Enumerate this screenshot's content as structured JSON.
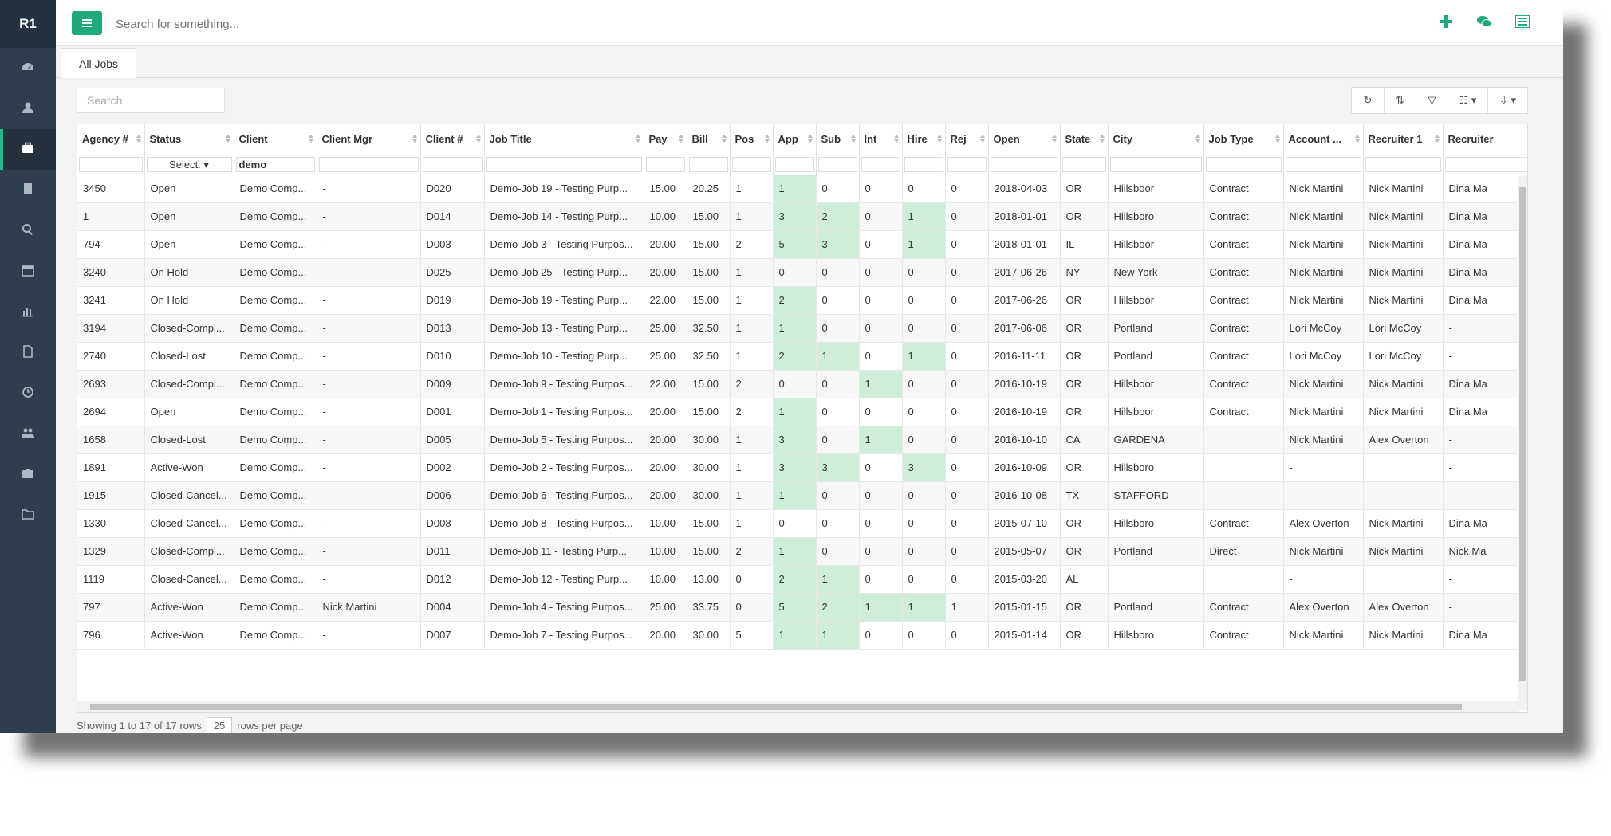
{
  "app": {
    "brand": "R1"
  },
  "sidebar": {
    "items": [
      {
        "icon": "dashboard-icon"
      },
      {
        "icon": "user-icon"
      },
      {
        "icon": "briefcase-icon",
        "active": true
      },
      {
        "icon": "building-icon"
      },
      {
        "icon": "search-icon"
      },
      {
        "icon": "calendar-icon"
      },
      {
        "icon": "bar-chart-icon"
      },
      {
        "icon": "document-icon"
      },
      {
        "icon": "clock-icon"
      },
      {
        "icon": "users-icon"
      },
      {
        "icon": "camera-icon"
      },
      {
        "icon": "folder-icon"
      }
    ]
  },
  "topbar": {
    "search_placeholder": "Search for something...",
    "icons": [
      "plus-icon",
      "chat-icon",
      "list-panel-icon"
    ],
    "accent": "#1ea97c"
  },
  "tabs": [
    {
      "label": "All Jobs"
    }
  ],
  "grid": {
    "search_placeholder": "Search",
    "columns": [
      "Agency #",
      "Status",
      "Client",
      "Client Mgr",
      "Client #",
      "Job Title",
      "Pay",
      "Bill",
      "Pos",
      "App",
      "Sub",
      "Int",
      "Hire",
      "Rej",
      "Open",
      "State",
      "City",
      "Job Type",
      "Account ...",
      "Recruiter 1",
      "Recruiter"
    ],
    "filters": {
      "status": "Select:",
      "client": "demo"
    },
    "rows": [
      [
        "3450",
        "Open",
        "Demo Comp...",
        "-",
        "D020",
        "Demo-Job 19 - Testing Purp...",
        "15.00",
        "20.25",
        "1",
        "1",
        "0",
        "0",
        "0",
        "0",
        "2018-04-03",
        "OR",
        "Hillsboor",
        "Contract",
        "Nick Martini",
        "Nick Martini",
        "Dina Ma"
      ],
      [
        "1",
        "Open",
        "Demo Comp...",
        "-",
        "D014",
        "Demo-Job 14 - Testing Purp...",
        "10.00",
        "15.00",
        "1",
        "3",
        "2",
        "0",
        "1",
        "0",
        "2018-01-01",
        "OR",
        "Hillsboro",
        "Contract",
        "Nick Martini",
        "Nick Martini",
        "Dina Ma"
      ],
      [
        "794",
        "Open",
        "Demo Comp...",
        "-",
        "D003",
        "Demo-Job 3 - Testing Purpos...",
        "20.00",
        "15.00",
        "2",
        "5",
        "3",
        "0",
        "1",
        "0",
        "2018-01-01",
        "IL",
        "Hillsboor",
        "Contract",
        "Nick Martini",
        "Nick Martini",
        "Dina Ma"
      ],
      [
        "3240",
        "On Hold",
        "Demo Comp...",
        "-",
        "D025",
        "Demo-Job 25 - Testing Purp...",
        "20.00",
        "15.00",
        "1",
        "0",
        "0",
        "0",
        "0",
        "0",
        "2017-06-26",
        "NY",
        "New York",
        "Contract",
        "Nick Martini",
        "Nick Martini",
        "Dina Ma"
      ],
      [
        "3241",
        "On Hold",
        "Demo Comp...",
        "-",
        "D019",
        "Demo-Job 19 - Testing Purp...",
        "22.00",
        "15.00",
        "1",
        "2",
        "0",
        "0",
        "0",
        "0",
        "2017-06-26",
        "OR",
        "Hillsboor",
        "Contract",
        "Nick Martini",
        "Nick Martini",
        "Dina Ma"
      ],
      [
        "3194",
        "Closed-Compl...",
        "Demo Comp...",
        "-",
        "D013",
        "Demo-Job 13 - Testing Purp...",
        "25.00",
        "32.50",
        "1",
        "1",
        "0",
        "0",
        "0",
        "0",
        "2017-06-06",
        "OR",
        "Portland",
        "Contract",
        "Lori McCoy",
        "Lori McCoy",
        "-"
      ],
      [
        "2740",
        "Closed-Lost",
        "Demo Comp...",
        "-",
        "D010",
        "Demo-Job 10 - Testing Purp...",
        "25.00",
        "32.50",
        "1",
        "2",
        "1",
        "0",
        "1",
        "0",
        "2016-11-11",
        "OR",
        "Portland",
        "Contract",
        "Lori McCoy",
        "Lori McCoy",
        "-"
      ],
      [
        "2693",
        "Closed-Compl...",
        "Demo Comp...",
        "-",
        "D009",
        "Demo-Job 9 - Testing Purpos...",
        "22.00",
        "15.00",
        "2",
        "0",
        "0",
        "1",
        "0",
        "0",
        "2016-10-19",
        "OR",
        "Hillsboor",
        "Contract",
        "Nick Martini",
        "Nick Martini",
        "Dina Ma"
      ],
      [
        "2694",
        "Open",
        "Demo Comp...",
        "-",
        "D001",
        "Demo-Job 1 - Testing Purpos...",
        "20.00",
        "15.00",
        "2",
        "1",
        "0",
        "0",
        "0",
        "0",
        "2016-10-19",
        "OR",
        "Hillsboor",
        "Contract",
        "Nick Martini",
        "Nick Martini",
        "Dina Ma"
      ],
      [
        "1658",
        "Closed-Lost",
        "Demo Comp...",
        "-",
        "D005",
        "Demo-Job 5 - Testing Purpos...",
        "20.00",
        "30.00",
        "1",
        "3",
        "0",
        "1",
        "0",
        "0",
        "2016-10-10",
        "CA",
        "GARDENA",
        "",
        "Nick Martini",
        "Alex Overton",
        "-"
      ],
      [
        "1891",
        "Active-Won",
        "Demo Comp...",
        "-",
        "D002",
        "Demo-Job 2 - Testing Purpos...",
        "20.00",
        "30.00",
        "1",
        "3",
        "3",
        "0",
        "3",
        "0",
        "2016-10-09",
        "OR",
        "Hillsboro",
        "",
        "-",
        "",
        "-"
      ],
      [
        "1915",
        "Closed-Cancel...",
        "Demo Comp...",
        "-",
        "D006",
        "Demo-Job 6 - Testing Purpos...",
        "20.00",
        "30.00",
        "1",
        "1",
        "0",
        "0",
        "0",
        "0",
        "2016-10-08",
        "TX",
        "STAFFORD",
        "",
        "-",
        "",
        "-"
      ],
      [
        "1330",
        "Closed-Cancel...",
        "Demo Comp...",
        "-",
        "D008",
        "Demo-Job 8 - Testing Purpos...",
        "10.00",
        "15.00",
        "1",
        "0",
        "0",
        "0",
        "0",
        "0",
        "2015-07-10",
        "OR",
        "Hillsboro",
        "Contract",
        "Alex Overton",
        "Nick Martini",
        "Dina Ma"
      ],
      [
        "1329",
        "Closed-Compl...",
        "Demo Comp...",
        "-",
        "D011",
        "Demo-Job 11 - Testing Purp...",
        "10.00",
        "15.00",
        "2",
        "1",
        "0",
        "0",
        "0",
        "0",
        "2015-05-07",
        "OR",
        "Portland",
        "Direct",
        "Nick Martini",
        "Nick Martini",
        "Nick Ma"
      ],
      [
        "1119",
        "Closed-Cancel...",
        "Demo Comp...",
        "-",
        "D012",
        "Demo-Job 12 - Testing Purp...",
        "10.00",
        "13.00",
        "0",
        "2",
        "1",
        "0",
        "0",
        "0",
        "2015-03-20",
        "AL",
        "",
        "",
        "-",
        "",
        "-"
      ],
      [
        "797",
        "Active-Won",
        "Demo Comp...",
        "Nick Martini",
        "D004",
        "Demo-Job 4 - Testing Purpos...",
        "25.00",
        "33.75",
        "0",
        "5",
        "2",
        "1",
        "1",
        "1",
        "2015-01-15",
        "OR",
        "Portland",
        "Contract",
        "Alex Overton",
        "Alex Overton",
        "-"
      ],
      [
        "796",
        "Active-Won",
        "Demo Comp...",
        "-",
        "D007",
        "Demo-Job 7 - Testing Purpos...",
        "20.00",
        "30.00",
        "5",
        "1",
        "1",
        "0",
        "0",
        "0",
        "2015-01-14",
        "OR",
        "Hillsboro",
        "Contract",
        "Nick Martini",
        "Nick Martini",
        "Dina Ma"
      ]
    ],
    "highlight_color": "#cfeed9"
  },
  "footer": {
    "showing": "Showing 1 to 17 of 17 rows",
    "per_page": "25",
    "per_page_suffix": "rows per page"
  }
}
